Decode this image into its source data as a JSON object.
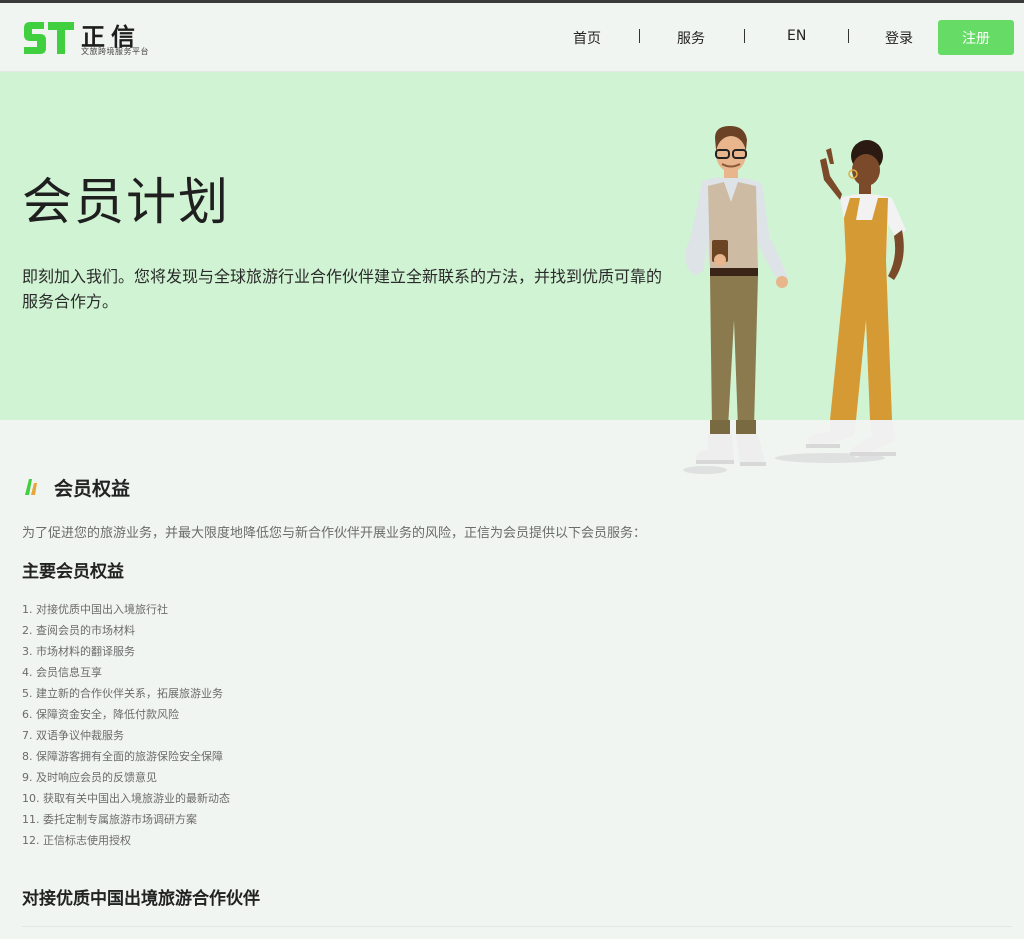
{
  "header": {
    "logo_text": "正信",
    "logo_tagline": "文旅跨境服务平台",
    "nav": [
      "首页",
      "服务",
      "EN",
      "登录"
    ],
    "register_label": "注册"
  },
  "hero": {
    "title": "会员计划",
    "description": "即刻加入我们。您将发现与全球旅游行业合作伙伴建立全新联系的方法，并找到优质可靠的服务合作方。"
  },
  "benefits": {
    "title": "会员权益",
    "intro": "为了促进您的旅游业务，并最大限度地降低您与新合作伙伴开展业务的风险，正信为会员提供以下会员服务：",
    "main_heading": "主要会员权益",
    "items": [
      "1. 对接优质中国出入境旅行社",
      "2. 查阅会员的市场材料",
      "3. 市场材料的翻译服务",
      "4. 会员信息互享",
      "5. 建立新的合作伙伴关系，拓展旅游业务",
      "6. 保障资金安全，降低付款风险",
      "7. 双语争议仲裁服务",
      "8. 保障游客拥有全面的旅游保险安全保障",
      "9. 及时响应会员的反馈意见",
      "10. 获取有关中国出入境旅游业的最新动态",
      "11. 委托定制专属旅游市场调研方案",
      "12. 正信标志使用授权"
    ],
    "next_heading": "对接优质中国出境旅游合作伙伴"
  },
  "colors": {
    "accent_green": "#66dc66",
    "logo_green": "#3fcf3f",
    "hero_bg": "#d0f4d3",
    "page_bg": "#f1f5f2"
  }
}
